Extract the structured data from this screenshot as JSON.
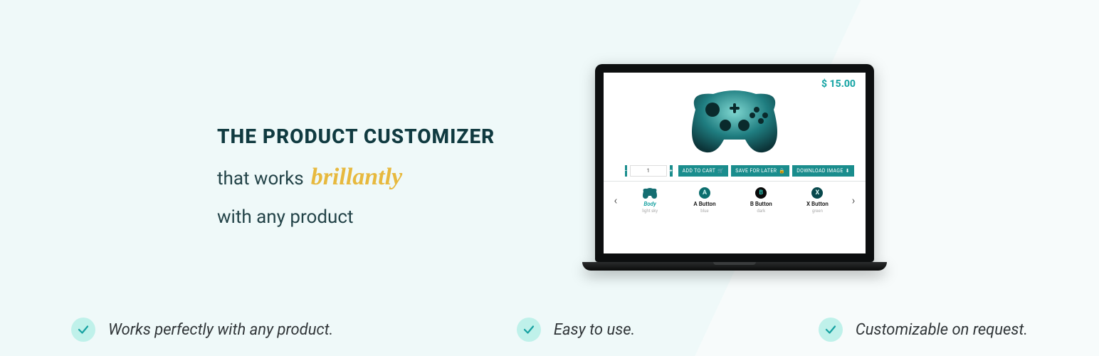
{
  "headline": {
    "title": "THE PRODUCT CUSTOMIZER",
    "line2_prefix": "that works",
    "line2_accent": "brillantly",
    "line3": "with any product"
  },
  "features": [
    {
      "text": "Works perfectly with any product."
    },
    {
      "text": "Easy to use."
    },
    {
      "text": "Customizable on request."
    }
  ],
  "mockup": {
    "price": "$ 15.00",
    "qty": {
      "minus": "-",
      "value": "1",
      "plus": "+"
    },
    "actions": {
      "add_to_cart": "ADD TO CART",
      "save_for_later": "SAVE FOR LATER",
      "download_image": "DOWNLOAD IMAGE"
    },
    "options": [
      {
        "title": "Body",
        "sub": "light sky",
        "type": "body",
        "active": true
      },
      {
        "title": "A Button",
        "sub": "blue",
        "type": "a",
        "active": false
      },
      {
        "title": "B Button",
        "sub": "dark",
        "type": "b",
        "active": false
      },
      {
        "title": "X Button",
        "sub": "green",
        "type": "x",
        "active": false
      }
    ],
    "colors": {
      "accent": "#1a8d8d",
      "price": "#1ea7a7",
      "script": "#e7b93e"
    }
  }
}
